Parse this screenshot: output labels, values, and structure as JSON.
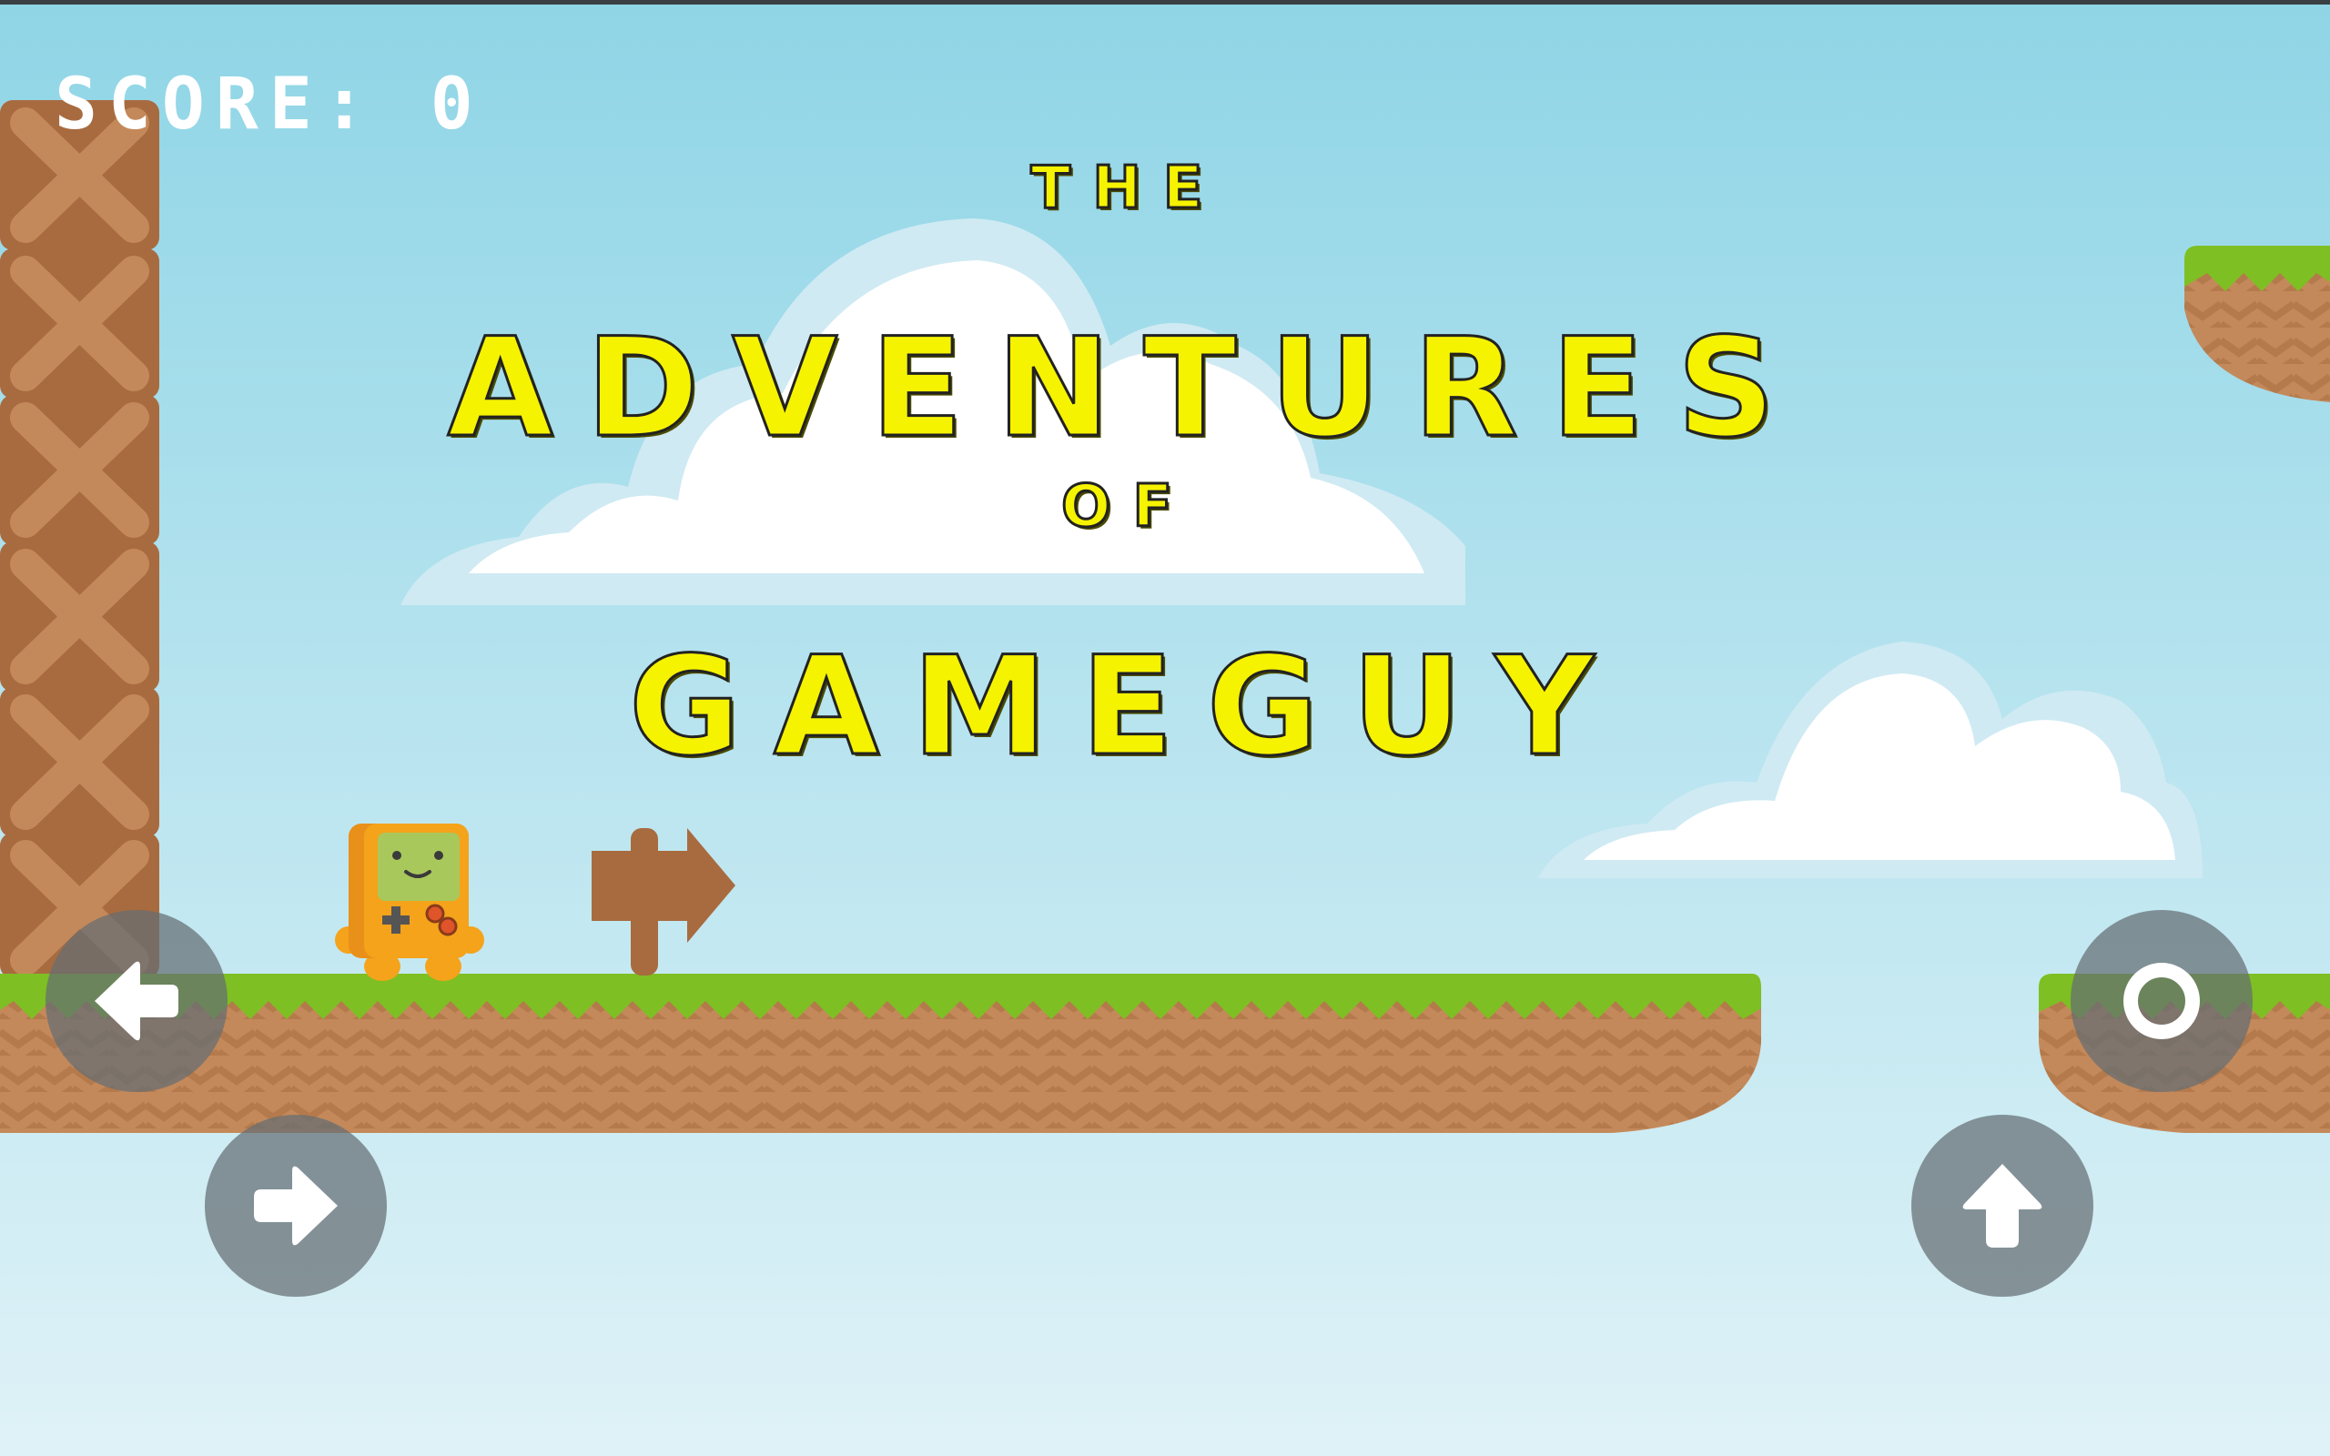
{
  "hud": {
    "score_label": "SCORE: 0"
  },
  "title": {
    "line1": "THE",
    "line2": "ADVENTURES",
    "line3": "OF",
    "line4": "GAMEGUY"
  },
  "controls": {
    "left_icon": "arrow-left-icon",
    "right_icon": "arrow-right-icon",
    "jump_icon": "arrow-up-icon",
    "action_icon": "ring-icon"
  },
  "colors": {
    "title_yellow": "#f6f300",
    "grass": "#7ebf23",
    "dirt": "#c4895a",
    "crate": "#a86b3f",
    "player": "#f4a31b",
    "button": "#656e73"
  }
}
